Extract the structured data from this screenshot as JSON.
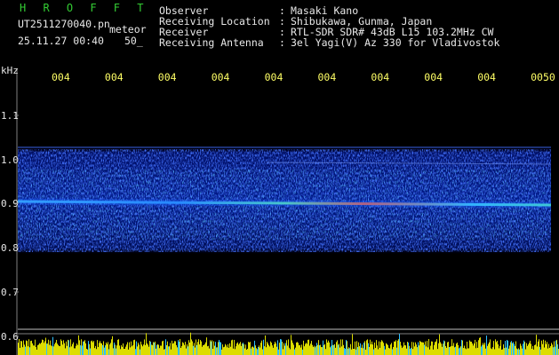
{
  "header": {
    "logo": "H R O F F T",
    "filename": "UT2511270040.pn",
    "mode": "meteor",
    "datetime": "25.11.27 00:40",
    "value": "50_",
    "fields": [
      {
        "label": "Observer",
        "sep": ":",
        "value": "Masaki Kano"
      },
      {
        "label": "Receiving Location",
        "sep": ":",
        "value": "Shibukawa, Gunma, Japan"
      },
      {
        "label": "Receiver",
        "sep": ":",
        "value": "RTL-SDR SDR# 43dB L15 103.2MHz CW"
      },
      {
        "label": "Receiving Antenna",
        "sep": ":",
        "value": "3el Yagi(V) Az 330 for Vladivostok"
      }
    ]
  },
  "axis": {
    "unit": "kHz",
    "time_ticks": [
      "004",
      "004",
      "004",
      "004",
      "004",
      "004",
      "004",
      "004",
      "004",
      "0050"
    ],
    "freq_ticks": [
      "1.1",
      "1.0",
      "0.9",
      "0.8",
      "0.7",
      "0.6"
    ]
  },
  "colors": {
    "background": "#000000",
    "timeText": "#ffff66",
    "headerText": "#e8e8e8",
    "logo": "#33cc33",
    "meter": "#dddd00"
  }
}
